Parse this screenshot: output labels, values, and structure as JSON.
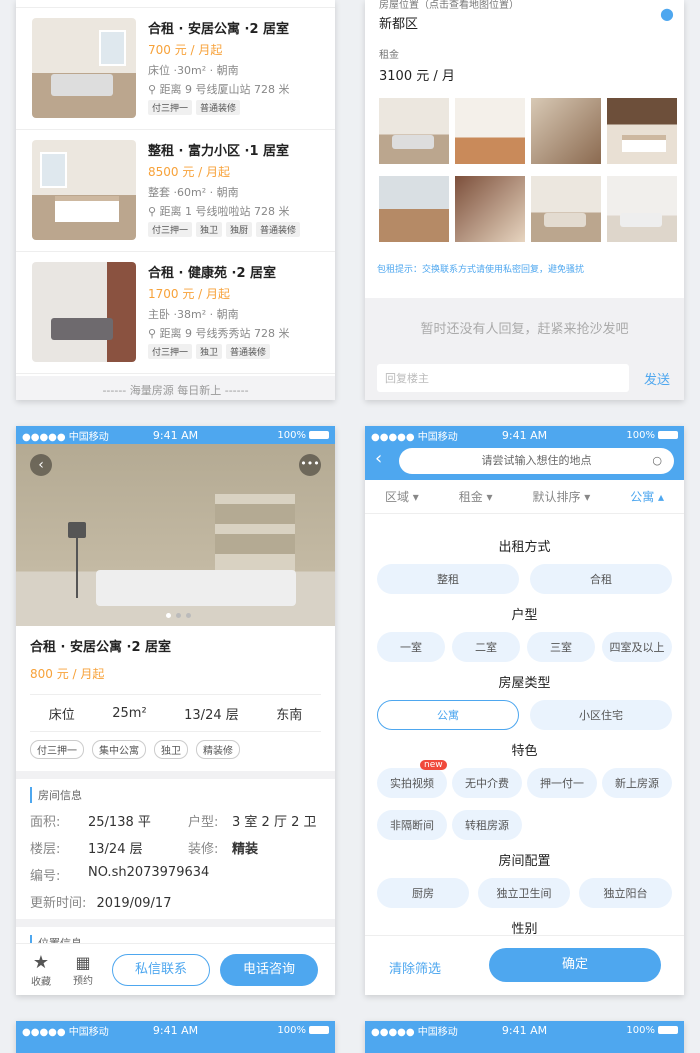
{
  "listing_screen": {
    "items": [
      {
        "title": "合租 · 安居公寓 ·2 居室",
        "price": "700 元 / 月起",
        "meta": "床位 ·30m² · 朝南",
        "distance": "距离 9 号线厦山站 728 米",
        "tags": [
          "付三押一",
          "普通装修"
        ]
      },
      {
        "title": "整租 · 富力小区 ·1 居室",
        "price": "8500 元 / 月起",
        "meta": "整套 ·60m² · 朝南",
        "distance": "距离 1 号线啦啦站 728 米",
        "tags": [
          "付三押一",
          "独卫",
          "独厨",
          "普通装修"
        ]
      },
      {
        "title": "合租 · 健康苑 ·2 居室",
        "price": "1700 元 / 月起",
        "meta": "主卧 ·38m² · 朝南",
        "distance": "距离 9 号线秀秀站 728 米",
        "tags": [
          "付三押一",
          "独卫",
          "普通装修"
        ]
      }
    ],
    "footer": "------ 海量房源 每日新上 ------"
  },
  "post_screen": {
    "location_label": "房屋位置（点击查看地图位置）",
    "location_value": "新都区",
    "rent_label": "租金",
    "rent_value": "3100 元 / 月",
    "tip": "包租提示：交换联系方式请使用私密回复，避免骚扰",
    "empty_reply": "暂时还没有人回复，赶紧来抢沙发吧",
    "reply_placeholder": "回复楼主",
    "send": "发送"
  },
  "status_bar": {
    "carrier": "●●●●● 中国移动",
    "time": "9:41 AM",
    "battery": "100%"
  },
  "detail_screen": {
    "title": "合租 · 安居公寓 ·2 居室",
    "price": "800 元 / 月起",
    "stats": [
      "床位",
      "25m²",
      "13/24 层",
      "东南"
    ],
    "tags": [
      "付三押一",
      "集中公寓",
      "独卫",
      "精装修"
    ],
    "room_info_title": "房间信息",
    "info": {
      "area_label": "面积:",
      "area": "25/138 平",
      "type_label": "户型:",
      "type": "3 室 2 厅 2 卫",
      "floor_label": "楼层:",
      "floor": "13/24 层",
      "deco_label": "装修:",
      "deco": "精装",
      "no_label": "编号:",
      "no": "NO.sh2073979634",
      "time_label": "更新时间:",
      "time": "2019/09/17"
    },
    "location_title": "位置信息",
    "fav": "收藏",
    "book": "预约",
    "message": "私信联系",
    "call": "电话咨询"
  },
  "filter_screen": {
    "search_placeholder": "请尝试输入想住的地点",
    "tabs": [
      "区域",
      "租金",
      "默认排序",
      "公寓"
    ],
    "rent_mode_title": "出租方式",
    "rent_modes": [
      "整租",
      "合租"
    ],
    "layout_title": "户型",
    "layouts": [
      "一室",
      "二室",
      "三室",
      "四室及以上"
    ],
    "house_type_title": "房屋类型",
    "house_types": [
      "公寓",
      "小区住宅"
    ],
    "feature_title": "特色",
    "features": [
      "实拍视频",
      "无中介费",
      "押一付一",
      "新上房源",
      "非隔断间",
      "转租房源"
    ],
    "new_badge": "new",
    "config_title": "房间配置",
    "configs": [
      "厨房",
      "独立卫生间",
      "独立阳台"
    ],
    "gender_title": "性别",
    "clear": "清除筛选",
    "confirm": "确定"
  },
  "colors": {
    "primary": "#4ea7ef",
    "price": "#f7a23a"
  }
}
